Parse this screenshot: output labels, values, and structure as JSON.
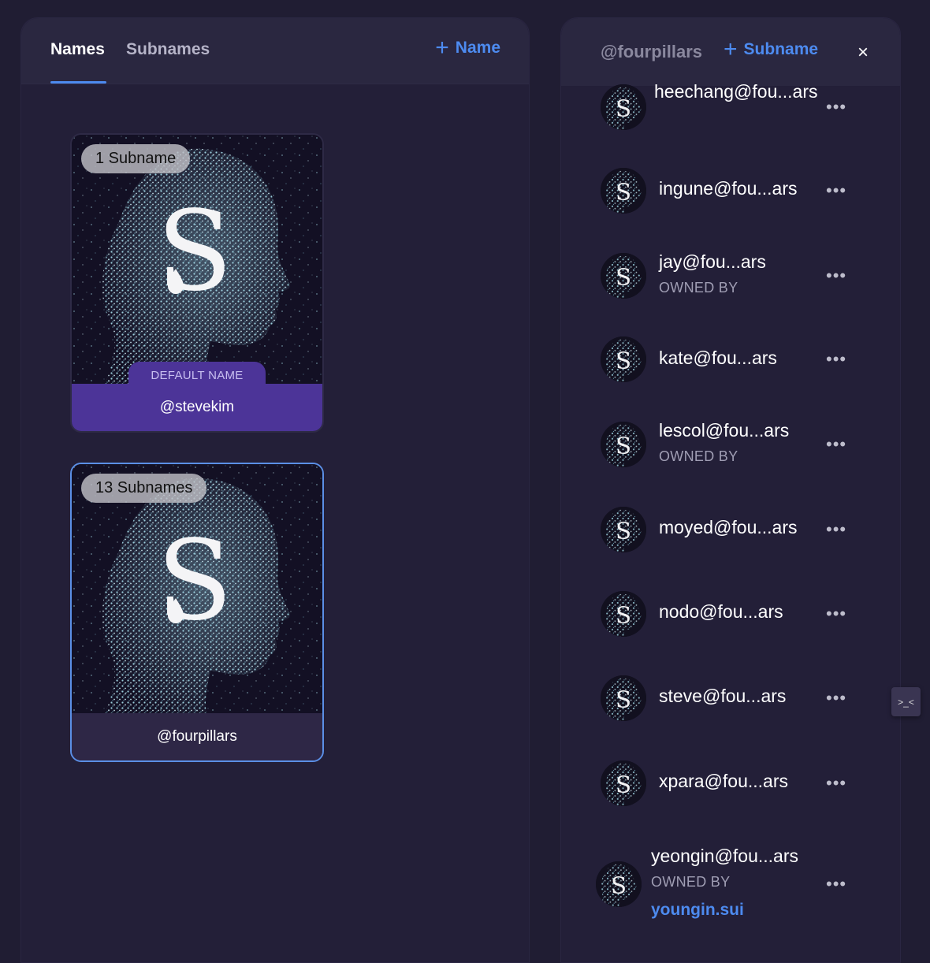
{
  "tabs": {
    "names_label": "Names",
    "subnames_label": "Subnames",
    "add_name_label": "Name"
  },
  "cards": [
    {
      "badge": "1 Subname",
      "default_label": "DEFAULT NAME",
      "name": "@stevekim"
    },
    {
      "badge": "13 Subnames",
      "name": "@fourpillars"
    }
  ],
  "subnames_panel": {
    "title": "@fourpillars",
    "add_subname_label": "Subname",
    "close_icon": "×",
    "items": [
      {
        "name": "heechang@fou...ars"
      },
      {
        "name": "ingune@fou...ars"
      },
      {
        "name": "jay@fou...ars",
        "owned_by": "OWNED BY"
      },
      {
        "name": "kate@fou...ars"
      },
      {
        "name": "lescol@fou...ars",
        "owned_by": "OWNED BY"
      },
      {
        "name": "moyed@fou...ars"
      },
      {
        "name": "nodo@fou...ars"
      },
      {
        "name": "steve@fou...ars"
      },
      {
        "name": "xpara@fou...ars"
      },
      {
        "name": "yeongin@fou...ars",
        "owned_by": "OWNED BY",
        "owner": "youngin.sui"
      }
    ],
    "more_icon": "•••"
  },
  "side_widget": {
    "icon": ">_<"
  },
  "colors": {
    "accent": "#4d8bf0",
    "default_purple": "#4c3498",
    "background": "#201d33"
  }
}
